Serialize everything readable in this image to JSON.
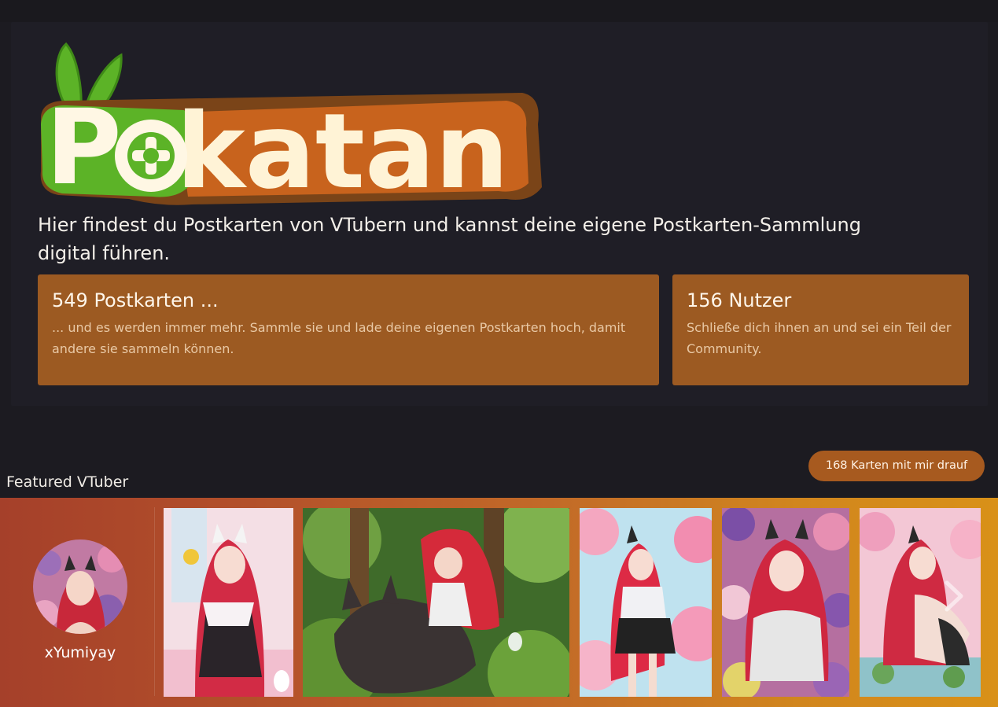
{
  "brand": {
    "logo_text": "Pokatan",
    "logo_icon": "plus-leaf-logo"
  },
  "hero": {
    "tagline": "Hier findest du Postkarten von VTubern und kannst deine eigene Postkarten-Sammlung digital führen."
  },
  "stats": [
    {
      "title": "549 Postkarten ...",
      "description": "... und es werden immer mehr. Sammle sie und lade deine eigenen Postkarten hoch, damit andere sie sammeln können."
    },
    {
      "title": "156 Nutzer",
      "description": "Schließe dich ihnen an und sei ein Teil der Community."
    }
  ],
  "featured": {
    "label": "Featured VTuber",
    "badge": "168 Karten mit mir drauf",
    "vtuber_name": "xYumiyay",
    "cards": [
      {
        "icon": "postcard-image"
      },
      {
        "icon": "postcard-image"
      },
      {
        "icon": "postcard-image"
      },
      {
        "icon": "postcard-image"
      },
      {
        "icon": "postcard-image"
      }
    ],
    "next_icon": "chevron-right-icon"
  },
  "colors": {
    "page_bg": "#1c1b21",
    "accent_orange": "#9c5a22",
    "logo_green": "#5cb327",
    "logo_orange": "#e87a1e",
    "logo_brown": "#7a4418"
  }
}
